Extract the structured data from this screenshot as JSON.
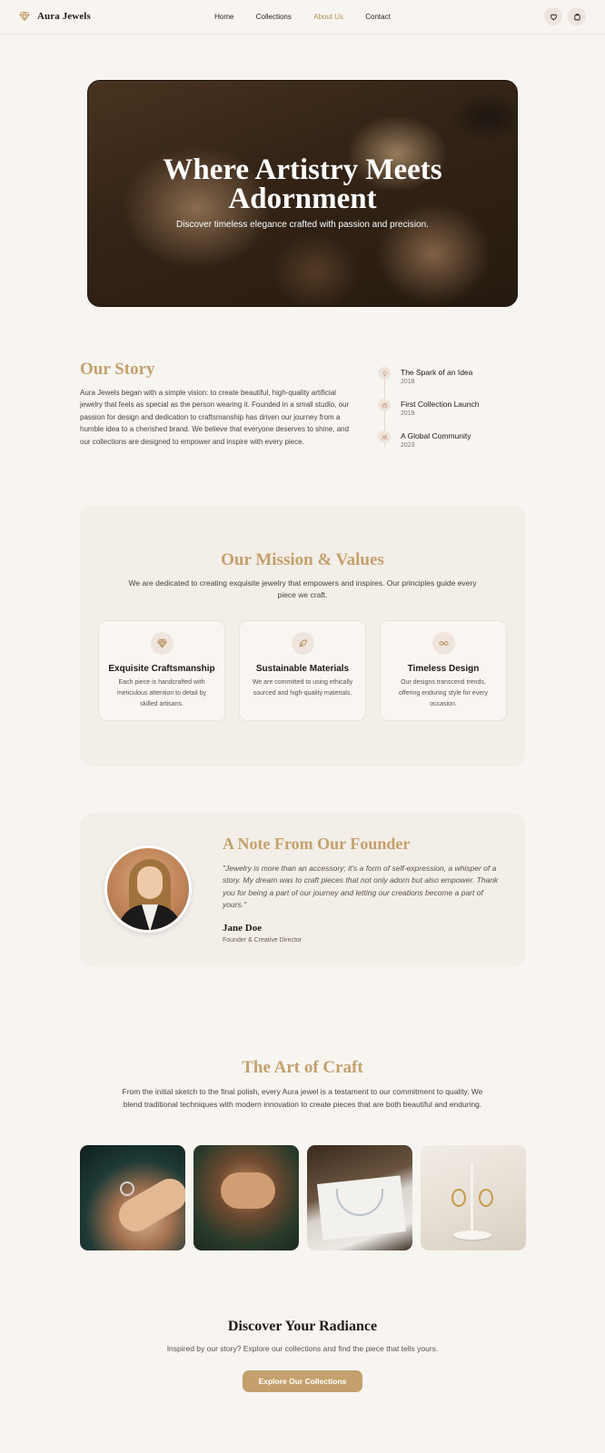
{
  "brand": {
    "name": "Aura Jewels",
    "accent": "#c4a06c",
    "background": "#f8f5f1"
  },
  "nav": {
    "links": [
      {
        "label": "Home",
        "active": false
      },
      {
        "label": "Collections",
        "active": false
      },
      {
        "label": "About Us",
        "active": true
      },
      {
        "label": "Contact",
        "active": false
      }
    ],
    "icons": [
      "heart-icon",
      "shopping-bag-icon"
    ]
  },
  "hero": {
    "title_line1": "Where Artistry Meets",
    "title_line2": "Adornment",
    "subtitle": "Discover timeless elegance crafted with passion and precision."
  },
  "story": {
    "title": "Our Story",
    "text": "Aura Jewels began with a simple vision: to create beautiful, high-quality artificial jewelry that feels as special as the person wearing it. Founded in a small studio, our passion for design and dedication to craftsmanship has driven our journey from a humble idea to a cherished brand. We believe that everyone deserves to shine, and our collections are designed to empower and inspire with every piece.",
    "timeline": [
      {
        "icon": "lightbulb-icon",
        "title": "The Spark of an Idea",
        "year": "2018"
      },
      {
        "icon": "box-icon",
        "title": "First Collection Launch",
        "year": "2019"
      },
      {
        "icon": "users-icon",
        "title": "A Global Community",
        "year": "2023"
      }
    ]
  },
  "mission": {
    "title": "Our Mission & Values",
    "subtitle": "We are dedicated to creating exquisite jewelry that empowers and inspires. Our principles guide every piece we craft.",
    "cards": [
      {
        "icon": "diamond-icon",
        "title": "Exquisite Craftsmanship",
        "text": "Each piece is handcrafted with meticulous attention to detail by skilled artisans."
      },
      {
        "icon": "leaf-icon",
        "title": "Sustainable Materials",
        "text": "We are committed to using ethically sourced and high-quality materials."
      },
      {
        "icon": "infinity-icon",
        "title": "Timeless Design",
        "text": "Our designs transcend trends, offering enduring style for every occasion."
      }
    ]
  },
  "founder": {
    "title": "A Note From Our Founder",
    "quote": "\"Jewelry is more than an accessory; it's a form of self-expression, a whisper of a story. My dream was to craft pieces that not only adorn but also empower. Thank you for being a part of our journey and letting our creations become a part of yours.\"",
    "name": "Jane Doe",
    "role": "Founder & Creative Director"
  },
  "craft": {
    "title": "The Art of Craft",
    "subtitle": "From the initial sketch to the final polish, every Aura jewel is a testament to our commitment to quality. We blend traditional techniques with modern innovation to create pieces that are both beautiful and enduring."
  },
  "cta": {
    "title": "Discover Your Radiance",
    "subtitle": "Inspired by our story? Explore our collections and find the piece that tells yours.",
    "button_label": "Explore Our Collections"
  }
}
